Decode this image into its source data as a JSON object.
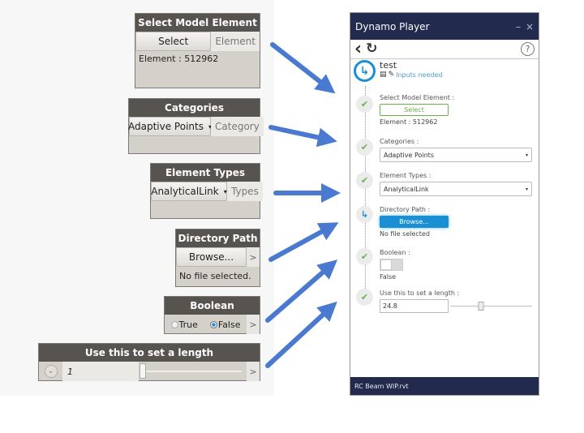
{
  "colors": {
    "arrow": "#4a79d0",
    "node_header": "#57534f",
    "node_body": "#d4d0ca",
    "player_titlebar": "#222a4e",
    "accent_blue": "#1a8fd3",
    "success_green": "#6ab04c"
  },
  "dynamo_nodes": {
    "select_model_element": {
      "title": "Select Model Element",
      "button_label": "Select",
      "output_port": "Element",
      "result": "Element : 512962"
    },
    "categories": {
      "title": "Categories",
      "selected": "Adaptive Points",
      "caret": "▾",
      "output_port": "Category"
    },
    "element_types": {
      "title": "Element Types",
      "selected": "AnalyticalLink",
      "caret": "▾",
      "output_port": "Types"
    },
    "directory_path": {
      "title": "Directory Path",
      "button_label": "Browse...",
      "output_arrow": ">",
      "status": "No file selected."
    },
    "boolean": {
      "title": "Boolean",
      "option_true": "True",
      "option_false": "False",
      "selected": "False",
      "output_arrow": ">"
    },
    "length_slider": {
      "title": "Use this to set a length",
      "value": "1",
      "output_arrow": ">",
      "expand_icon": "⌄"
    }
  },
  "player": {
    "window_title": "Dynamo Player",
    "minimize_icon": "–",
    "close_icon": "×",
    "back_icon": "‹",
    "refresh_icon": "↻",
    "help_icon": "?",
    "script": {
      "name": "test",
      "status": "Inputs needed",
      "run_icon": "↳",
      "save_icon": "▤",
      "edit_icon": "✎"
    },
    "steps": [
      {
        "label": "Select Model Element :",
        "state": "done",
        "icon": "✔",
        "button": "Select",
        "note": "Element : 512962"
      },
      {
        "label": "Categories :",
        "state": "done",
        "icon": "✔",
        "value": "Adaptive Points",
        "caret": "▾"
      },
      {
        "label": "Element Types :",
        "state": "done",
        "icon": "✔",
        "value": "AnalyticalLink",
        "caret": "▾"
      },
      {
        "label": "Directory Path :",
        "state": "pending",
        "icon": "↳",
        "button": "Browse...",
        "note": "No file selected"
      },
      {
        "label": "Boolean :",
        "state": "done",
        "icon": "✔",
        "toggle_on": false,
        "note": "False"
      },
      {
        "label": "Use this to set a length :",
        "state": "done",
        "icon": "✔",
        "value": "24.8",
        "slider_fraction": 0.38
      }
    ],
    "footer": "RC Beam WIP.rvt"
  }
}
